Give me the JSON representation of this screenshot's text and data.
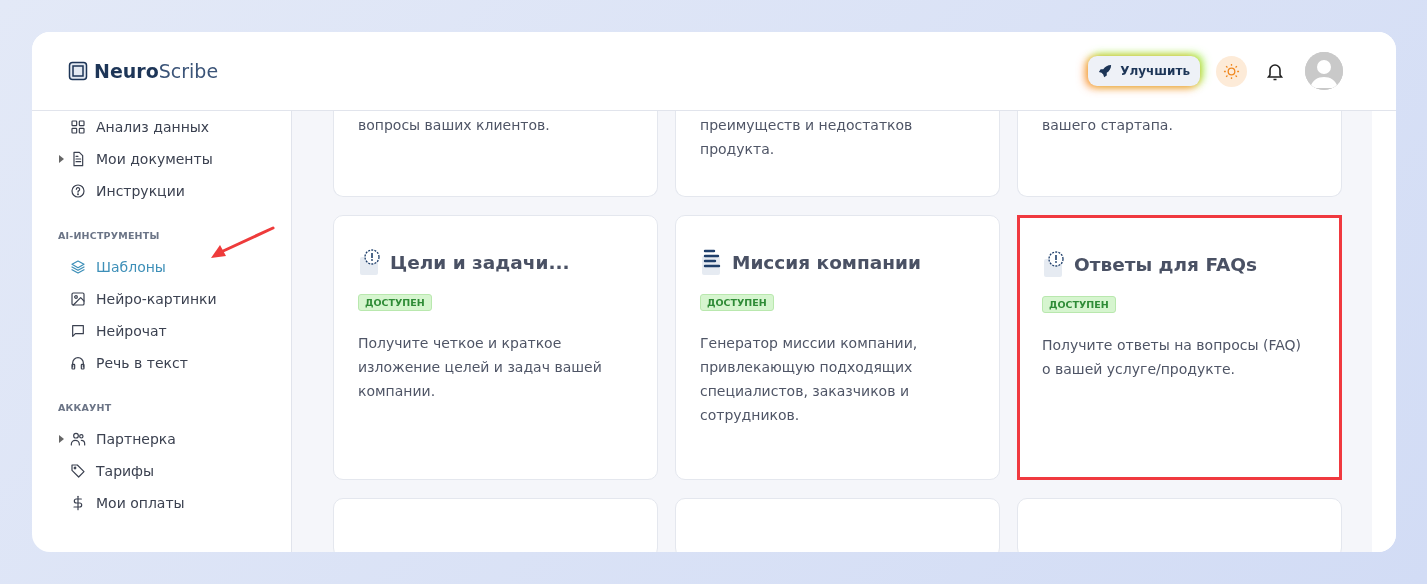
{
  "header": {
    "logo_bold": "Neuro",
    "logo_light": "Scribe",
    "upgrade_button": "Улучшить"
  },
  "sidebar": {
    "groups": [
      {
        "items": [
          {
            "label": "Анализ данных",
            "expandable": false,
            "selected": false
          },
          {
            "label": "Мои документы",
            "expandable": true,
            "selected": false
          },
          {
            "label": "Инструкции",
            "expandable": false,
            "selected": false
          }
        ]
      },
      {
        "title": "AI-ИНСТРУМЕНТЫ",
        "items": [
          {
            "label": "Шаблоны",
            "expandable": false,
            "selected": true
          },
          {
            "label": "Нейро-картинки",
            "expandable": false,
            "selected": false
          },
          {
            "label": "Нейрочат",
            "expandable": false,
            "selected": false
          },
          {
            "label": "Речь в текст",
            "expandable": false,
            "selected": false
          }
        ]
      },
      {
        "title": "АККАУНТ",
        "items": [
          {
            "label": "Партнерка",
            "expandable": true,
            "selected": false
          },
          {
            "label": "Тарифы",
            "expandable": false,
            "selected": false
          },
          {
            "label": "Мои оплаты",
            "expandable": false,
            "selected": false
          }
        ]
      }
    ]
  },
  "cards": [
    {
      "kind": "partial",
      "description": "вопросы ваших клиентов."
    },
    {
      "kind": "partial",
      "description": "преимуществ и недостатков продукта."
    },
    {
      "kind": "partial",
      "description": "вашего стартапа."
    },
    {
      "kind": "full",
      "title": "Цели и задачи...",
      "badge": "ДОСТУПЕН",
      "description": "Получите четкое и краткое изложение целей и задач вашей компании.",
      "highlighted": false
    },
    {
      "kind": "full",
      "title": "Миссия компании",
      "badge": "ДОСТУПЕН",
      "description": "Генератор миссии компании, привлекающую подходящих специалистов, заказчиков и сотрудников.",
      "highlighted": false
    },
    {
      "kind": "full",
      "title": "Ответы для FAQs",
      "badge": "ДОСТУПЕН",
      "description": "Получите ответы на вопросы (FAQ) о вашей услуге/продукте.",
      "highlighted": true
    },
    {
      "kind": "empty"
    },
    {
      "kind": "empty"
    },
    {
      "kind": "empty"
    }
  ]
}
